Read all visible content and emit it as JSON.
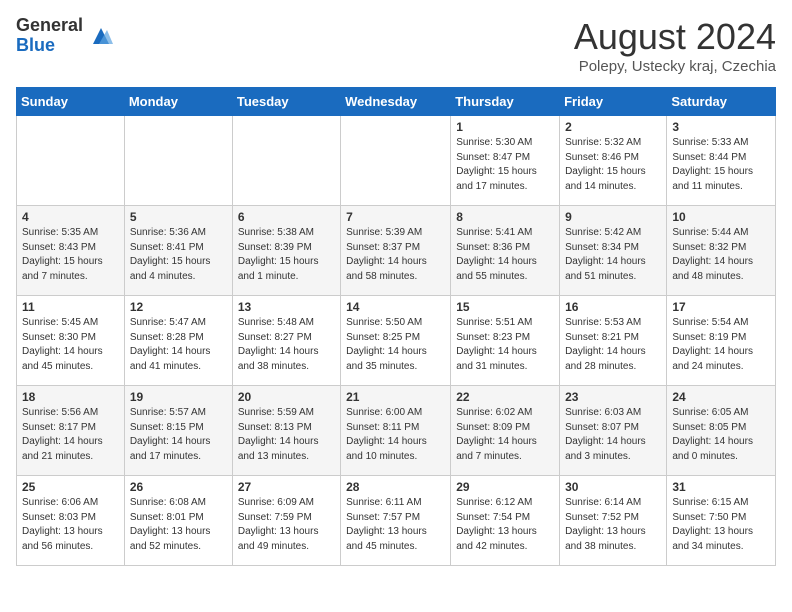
{
  "logo": {
    "general": "General",
    "blue": "Blue"
  },
  "title": {
    "month_year": "August 2024",
    "location": "Polepy, Ustecky kraj, Czechia"
  },
  "weekdays": [
    "Sunday",
    "Monday",
    "Tuesday",
    "Wednesday",
    "Thursday",
    "Friday",
    "Saturday"
  ],
  "weeks": [
    [
      {
        "day": "",
        "info": ""
      },
      {
        "day": "",
        "info": ""
      },
      {
        "day": "",
        "info": ""
      },
      {
        "day": "",
        "info": ""
      },
      {
        "day": "1",
        "info": "Sunrise: 5:30 AM\nSunset: 8:47 PM\nDaylight: 15 hours and 17 minutes."
      },
      {
        "day": "2",
        "info": "Sunrise: 5:32 AM\nSunset: 8:46 PM\nDaylight: 15 hours and 14 minutes."
      },
      {
        "day": "3",
        "info": "Sunrise: 5:33 AM\nSunset: 8:44 PM\nDaylight: 15 hours and 11 minutes."
      }
    ],
    [
      {
        "day": "4",
        "info": "Sunrise: 5:35 AM\nSunset: 8:43 PM\nDaylight: 15 hours and 7 minutes."
      },
      {
        "day": "5",
        "info": "Sunrise: 5:36 AM\nSunset: 8:41 PM\nDaylight: 15 hours and 4 minutes."
      },
      {
        "day": "6",
        "info": "Sunrise: 5:38 AM\nSunset: 8:39 PM\nDaylight: 15 hours and 1 minute."
      },
      {
        "day": "7",
        "info": "Sunrise: 5:39 AM\nSunset: 8:37 PM\nDaylight: 14 hours and 58 minutes."
      },
      {
        "day": "8",
        "info": "Sunrise: 5:41 AM\nSunset: 8:36 PM\nDaylight: 14 hours and 55 minutes."
      },
      {
        "day": "9",
        "info": "Sunrise: 5:42 AM\nSunset: 8:34 PM\nDaylight: 14 hours and 51 minutes."
      },
      {
        "day": "10",
        "info": "Sunrise: 5:44 AM\nSunset: 8:32 PM\nDaylight: 14 hours and 48 minutes."
      }
    ],
    [
      {
        "day": "11",
        "info": "Sunrise: 5:45 AM\nSunset: 8:30 PM\nDaylight: 14 hours and 45 minutes."
      },
      {
        "day": "12",
        "info": "Sunrise: 5:47 AM\nSunset: 8:28 PM\nDaylight: 14 hours and 41 minutes."
      },
      {
        "day": "13",
        "info": "Sunrise: 5:48 AM\nSunset: 8:27 PM\nDaylight: 14 hours and 38 minutes."
      },
      {
        "day": "14",
        "info": "Sunrise: 5:50 AM\nSunset: 8:25 PM\nDaylight: 14 hours and 35 minutes."
      },
      {
        "day": "15",
        "info": "Sunrise: 5:51 AM\nSunset: 8:23 PM\nDaylight: 14 hours and 31 minutes."
      },
      {
        "day": "16",
        "info": "Sunrise: 5:53 AM\nSunset: 8:21 PM\nDaylight: 14 hours and 28 minutes."
      },
      {
        "day": "17",
        "info": "Sunrise: 5:54 AM\nSunset: 8:19 PM\nDaylight: 14 hours and 24 minutes."
      }
    ],
    [
      {
        "day": "18",
        "info": "Sunrise: 5:56 AM\nSunset: 8:17 PM\nDaylight: 14 hours and 21 minutes."
      },
      {
        "day": "19",
        "info": "Sunrise: 5:57 AM\nSunset: 8:15 PM\nDaylight: 14 hours and 17 minutes."
      },
      {
        "day": "20",
        "info": "Sunrise: 5:59 AM\nSunset: 8:13 PM\nDaylight: 14 hours and 13 minutes."
      },
      {
        "day": "21",
        "info": "Sunrise: 6:00 AM\nSunset: 8:11 PM\nDaylight: 14 hours and 10 minutes."
      },
      {
        "day": "22",
        "info": "Sunrise: 6:02 AM\nSunset: 8:09 PM\nDaylight: 14 hours and 7 minutes."
      },
      {
        "day": "23",
        "info": "Sunrise: 6:03 AM\nSunset: 8:07 PM\nDaylight: 14 hours and 3 minutes."
      },
      {
        "day": "24",
        "info": "Sunrise: 6:05 AM\nSunset: 8:05 PM\nDaylight: 14 hours and 0 minutes."
      }
    ],
    [
      {
        "day": "25",
        "info": "Sunrise: 6:06 AM\nSunset: 8:03 PM\nDaylight: 13 hours and 56 minutes."
      },
      {
        "day": "26",
        "info": "Sunrise: 6:08 AM\nSunset: 8:01 PM\nDaylight: 13 hours and 52 minutes."
      },
      {
        "day": "27",
        "info": "Sunrise: 6:09 AM\nSunset: 7:59 PM\nDaylight: 13 hours and 49 minutes."
      },
      {
        "day": "28",
        "info": "Sunrise: 6:11 AM\nSunset: 7:57 PM\nDaylight: 13 hours and 45 minutes."
      },
      {
        "day": "29",
        "info": "Sunrise: 6:12 AM\nSunset: 7:54 PM\nDaylight: 13 hours and 42 minutes."
      },
      {
        "day": "30",
        "info": "Sunrise: 6:14 AM\nSunset: 7:52 PM\nDaylight: 13 hours and 38 minutes."
      },
      {
        "day": "31",
        "info": "Sunrise: 6:15 AM\nSunset: 7:50 PM\nDaylight: 13 hours and 34 minutes."
      }
    ]
  ]
}
